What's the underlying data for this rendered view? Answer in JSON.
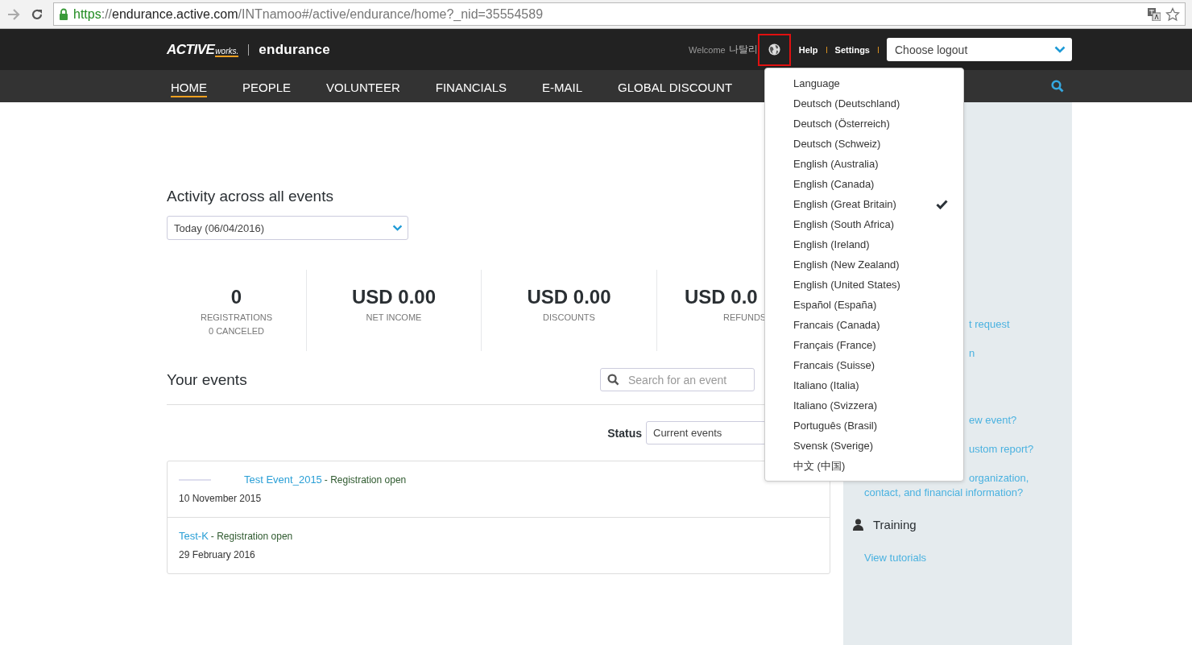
{
  "browser": {
    "url": {
      "scheme": "https",
      "separator": "://",
      "host": "endurance.active.com",
      "path": "/INTnamoo#/active/endurance/home?_nid=35554589"
    }
  },
  "header": {
    "logo": {
      "brand": "ACTIVE",
      "sub": "works.",
      "product": "endurance"
    },
    "welcome": "Welcome",
    "user": "나탈리",
    "links": [
      "Help",
      "Settings"
    ],
    "logout_select": {
      "value": "Choose logout"
    }
  },
  "nav": [
    {
      "label": "HOME",
      "selected": true
    },
    {
      "label": "PEOPLE",
      "selected": false
    },
    {
      "label": "VOLUNTEER",
      "selected": false
    },
    {
      "label": "FINANCIALS",
      "selected": false
    },
    {
      "label": "E-MAIL",
      "selected": false
    },
    {
      "label": "GLOBAL DISCOUNT",
      "selected": false
    }
  ],
  "activity": {
    "title": "Activity across all events",
    "period_select": {
      "value": "Today (06/04/2016)"
    },
    "stats": [
      {
        "value": "0",
        "label": "REGISTRATIONS",
        "sub": "0 CANCELED"
      },
      {
        "value": "USD 0.00",
        "label": "NET INCOME"
      },
      {
        "value": "USD 0.00",
        "label": "DISCOUNTS"
      },
      {
        "value": "USD 0.0",
        "label": "REFUNDS"
      }
    ]
  },
  "events": {
    "title": "Your events",
    "search": {
      "placeholder": "Search for an event"
    },
    "status_label": "Status",
    "status_select": {
      "value": "Current events"
    },
    "rows": [
      {
        "name": "Test Event_2015",
        "status": "- Registration open",
        "date": "10 November 2015",
        "redacted": true
      },
      {
        "name": "Test-K",
        "status": "- Registration open",
        "date": "29 February 2016",
        "redacted": false
      }
    ]
  },
  "sidebar": {
    "links": [
      "t request",
      "n",
      "ew event?",
      "ustom report?",
      "organization, contact, and financial information?"
    ],
    "training": {
      "title": "Training",
      "links": [
        "View tutorials"
      ]
    }
  },
  "language_menu": {
    "title": "Language",
    "items": [
      {
        "label": "Deutsch (Deutschland)",
        "selected": false
      },
      {
        "label": "Deutsch (Österreich)",
        "selected": false
      },
      {
        "label": "Deutsch (Schweiz)",
        "selected": false
      },
      {
        "label": "English (Australia)",
        "selected": false
      },
      {
        "label": "English (Canada)",
        "selected": false
      },
      {
        "label": "English (Great Britain)",
        "selected": true
      },
      {
        "label": "English (South Africa)",
        "selected": false
      },
      {
        "label": "English (Ireland)",
        "selected": false
      },
      {
        "label": "English (New Zealand)",
        "selected": false
      },
      {
        "label": "English (United States)",
        "selected": false
      },
      {
        "label": "Español (España)",
        "selected": false
      },
      {
        "label": "Francais (Canada)",
        "selected": false
      },
      {
        "label": "Français (France)",
        "selected": false
      },
      {
        "label": "Francais (Suisse)",
        "selected": false
      },
      {
        "label": "Italiano (Italia)",
        "selected": false
      },
      {
        "label": "Italiano (Svizzera)",
        "selected": false
      },
      {
        "label": "Português (Brasil)",
        "selected": false
      },
      {
        "label": "Svensk (Sverige)",
        "selected": false
      },
      {
        "label": "中文 (中国)",
        "selected": false
      }
    ]
  }
}
